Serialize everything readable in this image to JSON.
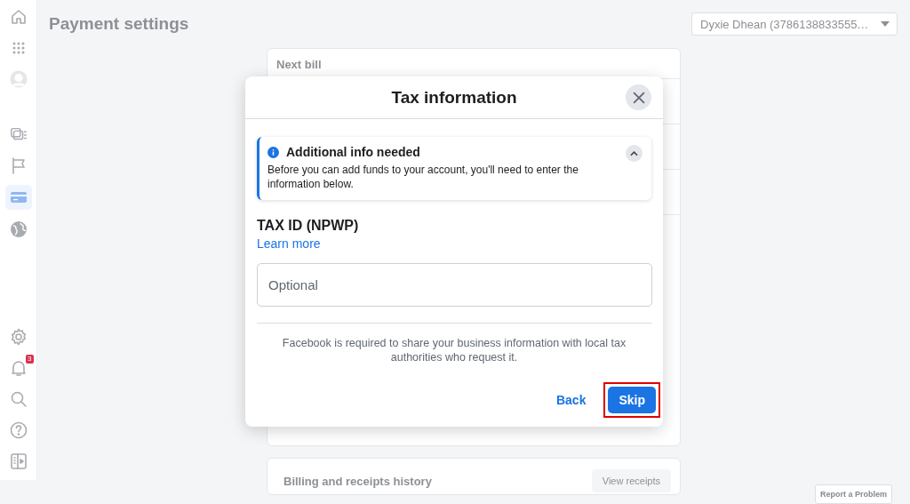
{
  "sidebar": {
    "items": [
      {
        "kind": "home",
        "selected": false
      },
      {
        "kind": "apps",
        "selected": false
      },
      {
        "kind": "avatar",
        "selected": false
      },
      {
        "kind": "pages",
        "selected": false
      },
      {
        "kind": "flag",
        "selected": false
      },
      {
        "kind": "card",
        "selected": true
      },
      {
        "kind": "globe",
        "selected": false
      }
    ],
    "bottom_items": [
      {
        "kind": "gear"
      },
      {
        "kind": "bell",
        "badge": "3"
      },
      {
        "kind": "search"
      },
      {
        "kind": "help"
      },
      {
        "kind": "panel"
      }
    ]
  },
  "page": {
    "title": "Payment settings",
    "account_selector": "Dyxie Dhean (3786138833555…",
    "cards": [
      {
        "title": "Next bill"
      },
      {
        "title": "Billing and receipts history",
        "button": "View receipts"
      }
    ],
    "report_button": "Report a Problem"
  },
  "dialog": {
    "title": "Tax information",
    "notice": {
      "title": "Additional info needed",
      "text": "Before you can add funds to your account, you'll need to enter the information below.",
      "expanded": true
    },
    "field": {
      "label": "TAX ID (NPWP)",
      "link": "Learn more",
      "placeholder": "Optional"
    },
    "disclaimer": "Facebook is required to share your business information with local tax authorities who request it.",
    "buttons": [
      {
        "label": "Back",
        "kind": "link",
        "highlighted": false
      },
      {
        "label": "Skip",
        "kind": "primary",
        "highlighted": true
      }
    ]
  }
}
